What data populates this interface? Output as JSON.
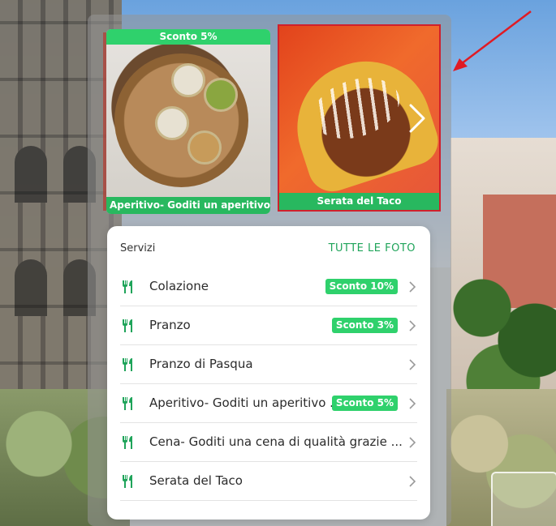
{
  "colors": {
    "accent": "#2fd16c",
    "link": "#1fa45a",
    "highlight": "#d0202c"
  },
  "slides": [
    {
      "badge": "Sconto 5%",
      "caption": "Aperitivo- Goditi un aperitivo di q"
    },
    {
      "caption": "Serata del Taco",
      "nav_icon": "chevron-right-icon"
    }
  ],
  "services": {
    "title": "Servizi",
    "all_photos": "TUTTE LE FOTO",
    "items": [
      {
        "name": "Colazione",
        "badge": "Sconto 10%",
        "icon": "fork-knife-icon"
      },
      {
        "name": "Pranzo",
        "badge": "Sconto 3%",
        "icon": "fork-knife-icon"
      },
      {
        "name": "Pranzo di Pasqua",
        "icon": "fork-knife-icon"
      },
      {
        "name": "Aperitivo- Goditi un aperitivo ...",
        "badge": "Sconto 5%",
        "icon": "fork-knife-icon"
      },
      {
        "name": "Cena- Goditi una cena di qualità grazie ...",
        "icon": "fork-knife-icon"
      },
      {
        "name": "Serata del Taco",
        "icon": "fork-knife-icon"
      }
    ]
  }
}
